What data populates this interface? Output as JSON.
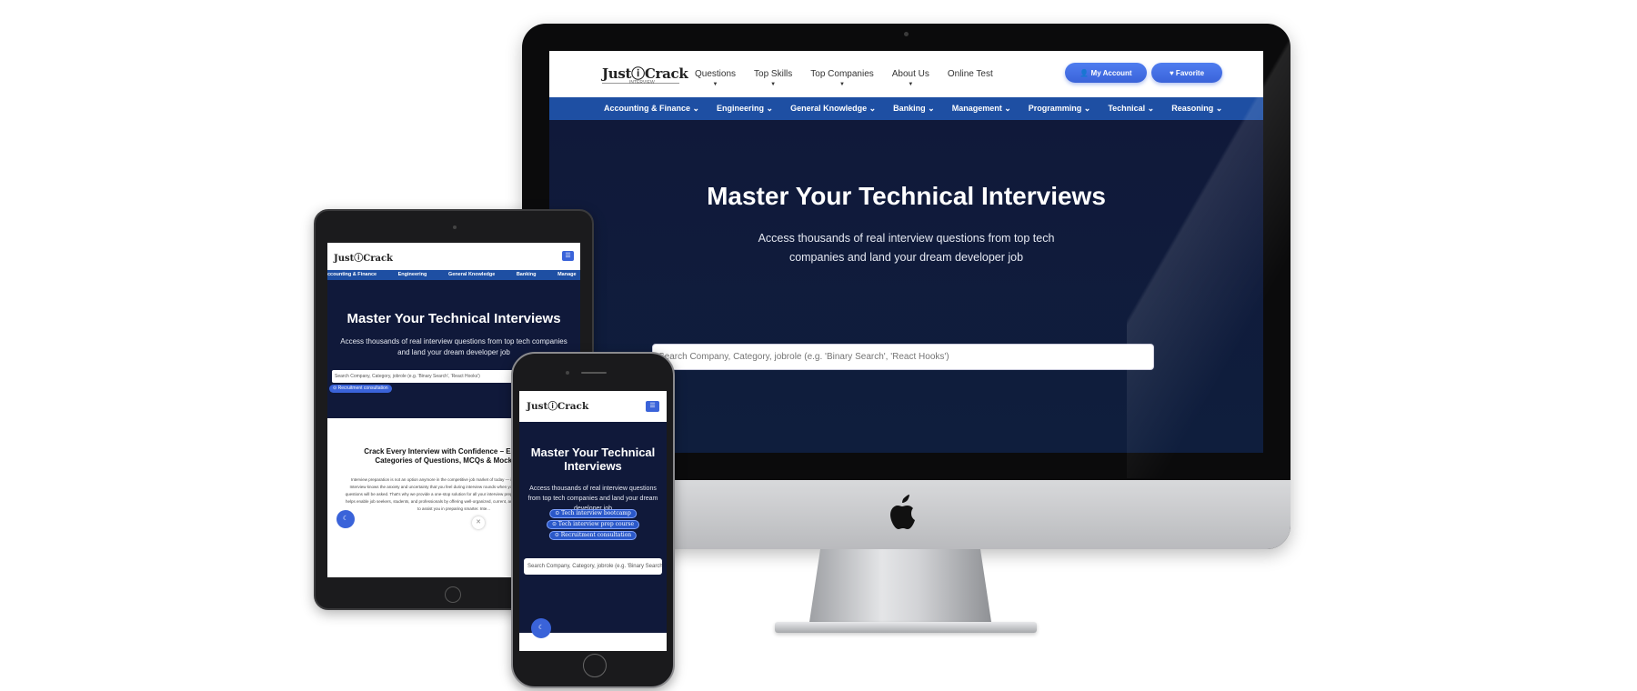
{
  "desktop": {
    "logo": "JustⓘCrack",
    "logo_sub": "INTERVIEW",
    "nav": [
      "Questions",
      "Top Skills",
      "Top Companies",
      "About Us",
      "Online Test"
    ],
    "account_button": "👤 My Account",
    "favorite_button": "♥ Favorite",
    "categories": [
      "Accounting & Finance ⌄",
      "Engineering ⌄",
      "General Knowledge ⌄",
      "Banking ⌄",
      "Management ⌄",
      "Programming ⌄",
      "Technical ⌄",
      "Reasoning ⌄"
    ],
    "hero_title": "Master Your Technical Interviews",
    "hero_subtitle": "Access thousands of real interview questions from top tech companies and land your dream developer job",
    "search_placeholder": "Search Company, Category, jobrole (e.g. 'Binary Search', 'React Hooks')"
  },
  "tablet": {
    "logo": "JustⓘCrack",
    "categories": [
      "ccounting & Finance",
      "Engineering",
      "General Knowledge",
      "Banking",
      "Manage"
    ],
    "hero_title": "Master Your Technical Interviews",
    "hero_subtitle": "Access thousands of real interview questions from top tech companies and land your dream developer job",
    "search_placeholder": "Search Company, Category, jobrole (e.g. 'Binary Search', 'React Hooks')",
    "chip": "⊙ Recruitment consultation",
    "section_title": "Crack Every Interview with Confidence – Explore All Categories of Questions, MCQs & Mock Tests",
    "section_text": "Interview preparation is not an option anymore in the competitive job market of today — it's necessary. Just Crack Interview knows the anxiety and uncertainty that you feel during interview rounds when you don't know what kind of questions will be asked. That's why we provide a one-stop solution for all your interview preparation needs. Our platform helps enable job seekers, students, and professionals by offering well-organized, current, and carefully selected content to assist you in preparing smarter. Inte...",
    "fab_icon": "☾",
    "close_icon": "✕"
  },
  "phone": {
    "logo": "JustⓘCrack",
    "hero_title": "Master Your Technical Interviews",
    "hero_subtitle": "Access thousands of real interview questions from top tech companies and land your dream developer job",
    "chips": [
      "⊙ Tech interview bootcamp",
      "⊙ Tech interview prep course",
      "⊙ Recruitment consultation"
    ],
    "search_placeholder": "Search Company, Category, jobrole (e.g. 'Binary Search', 'React Hooks')",
    "fab_icon": "☾"
  },
  "colors": {
    "accent": "#3a63d9",
    "category_bar": "#1e4fa3",
    "hero_bg": "#10193a"
  },
  "icons": {
    "menu": "hamburger-icon",
    "apple": "apple-logo",
    "theme": "moon-icon"
  }
}
